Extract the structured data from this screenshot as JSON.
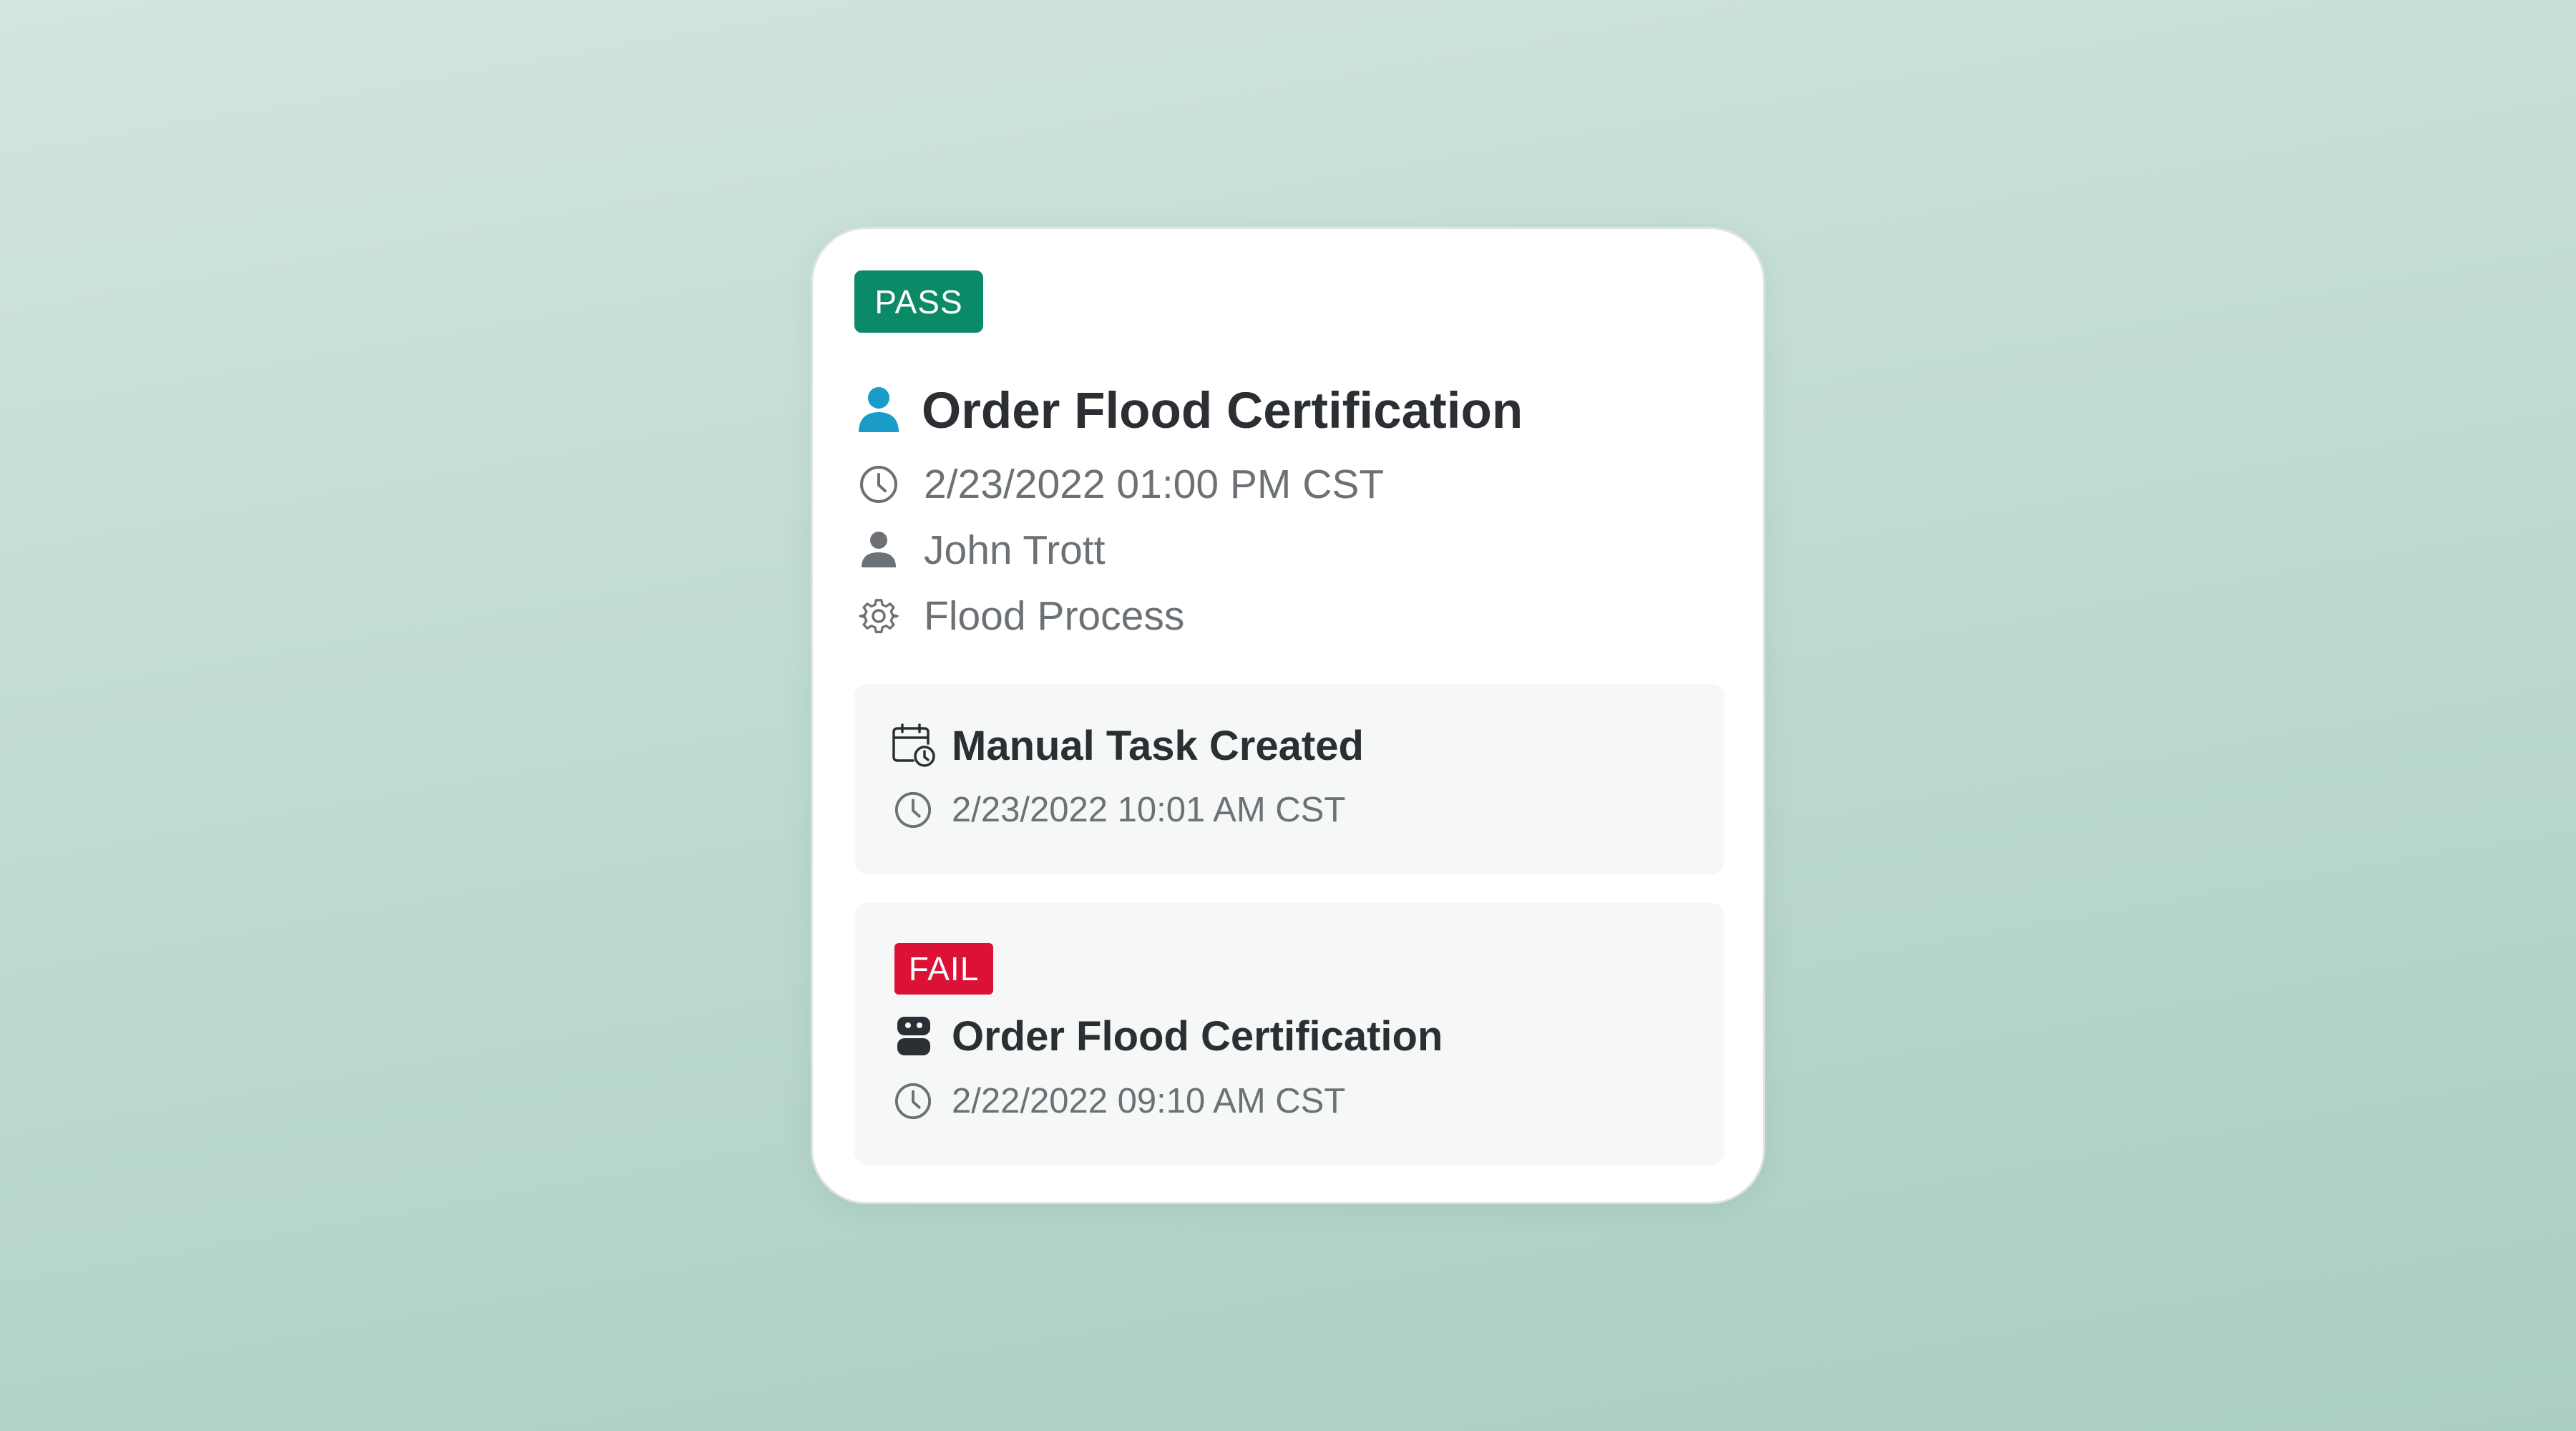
{
  "card": {
    "status_badge": "PASS",
    "title": "Order Flood Certification",
    "title_icon": "user-icon",
    "accent_color": "#1a9cc8",
    "pass_color": "#0b8a67",
    "fail_color": "#db1236",
    "datetime": "2/23/2022 01:00 PM CST",
    "assignee": "John Trott",
    "process": "Flood Process"
  },
  "events": [
    {
      "icon": "calendar-clock-icon",
      "title": "Manual Task Created",
      "datetime": "2/23/2022 10:01 AM CST"
    },
    {
      "status_badge": "FAIL",
      "icon": "robot-icon",
      "title": "Order Flood Certification",
      "datetime": "2/22/2022 09:10 AM CST"
    }
  ]
}
